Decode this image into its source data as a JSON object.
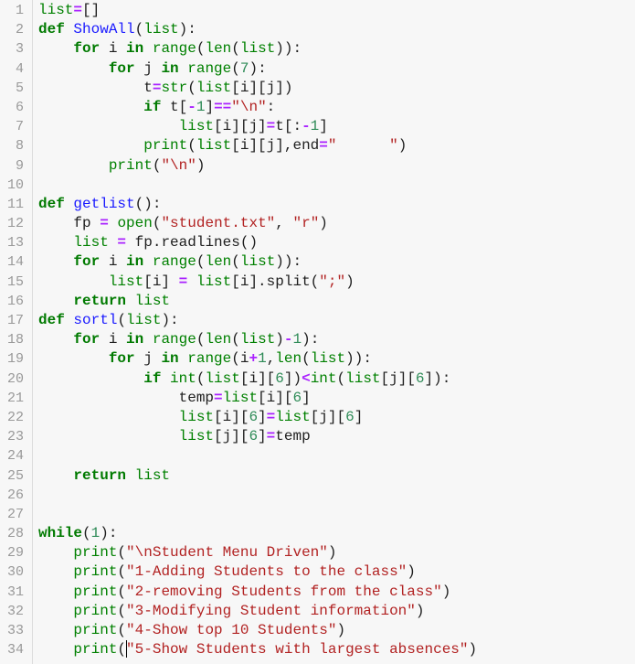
{
  "editor": {
    "cursor": {
      "line": 34,
      "after_token": 2,
      "after_char": 2
    },
    "lines": [
      {
        "n": "1",
        "tokens": [
          [
            "b",
            "list"
          ],
          [
            "o",
            "="
          ],
          [
            "p",
            "[]"
          ]
        ]
      },
      {
        "n": "2",
        "tokens": [
          [
            "k",
            "def"
          ],
          [
            "t",
            " "
          ],
          [
            "f",
            "ShowAll"
          ],
          [
            "p",
            "("
          ],
          [
            "b",
            "list"
          ],
          [
            "p",
            "):"
          ]
        ]
      },
      {
        "n": "3",
        "tokens": [
          [
            "t",
            "    "
          ],
          [
            "k",
            "for"
          ],
          [
            "t",
            " i "
          ],
          [
            "k",
            "in"
          ],
          [
            "t",
            " "
          ],
          [
            "b",
            "range"
          ],
          [
            "p",
            "("
          ],
          [
            "b",
            "len"
          ],
          [
            "p",
            "("
          ],
          [
            "b",
            "list"
          ],
          [
            "p",
            ")):"
          ]
        ]
      },
      {
        "n": "4",
        "tokens": [
          [
            "t",
            "        "
          ],
          [
            "k",
            "for"
          ],
          [
            "t",
            " j "
          ],
          [
            "k",
            "in"
          ],
          [
            "t",
            " "
          ],
          [
            "b",
            "range"
          ],
          [
            "p",
            "("
          ],
          [
            "n",
            "7"
          ],
          [
            "p",
            "):"
          ]
        ]
      },
      {
        "n": "5",
        "tokens": [
          [
            "t",
            "            t"
          ],
          [
            "o",
            "="
          ],
          [
            "b",
            "str"
          ],
          [
            "p",
            "("
          ],
          [
            "b",
            "list"
          ],
          [
            "p",
            "[i][j])"
          ]
        ]
      },
      {
        "n": "6",
        "tokens": [
          [
            "t",
            "            "
          ],
          [
            "k",
            "if"
          ],
          [
            "t",
            " t["
          ],
          [
            "o",
            "-"
          ],
          [
            "n",
            "1"
          ],
          [
            "p",
            "]"
          ],
          [
            "o",
            "=="
          ],
          [
            "s",
            "\"\\n\""
          ],
          [
            "p",
            ":"
          ]
        ]
      },
      {
        "n": "7",
        "tokens": [
          [
            "t",
            "                "
          ],
          [
            "b",
            "list"
          ],
          [
            "p",
            "[i][j]"
          ],
          [
            "o",
            "="
          ],
          [
            "t",
            "t[:"
          ],
          [
            "o",
            "-"
          ],
          [
            "n",
            "1"
          ],
          [
            "p",
            "]"
          ]
        ]
      },
      {
        "n": "8",
        "tokens": [
          [
            "t",
            "            "
          ],
          [
            "b",
            "print"
          ],
          [
            "p",
            "("
          ],
          [
            "b",
            "list"
          ],
          [
            "p",
            "[i][j],end"
          ],
          [
            "o",
            "="
          ],
          [
            "s",
            "\"      \""
          ],
          [
            "p",
            ")"
          ]
        ]
      },
      {
        "n": "9",
        "tokens": [
          [
            "t",
            "        "
          ],
          [
            "b",
            "print"
          ],
          [
            "p",
            "("
          ],
          [
            "s",
            "\"\\n\""
          ],
          [
            "p",
            ")"
          ]
        ]
      },
      {
        "n": "10",
        "tokens": []
      },
      {
        "n": "11",
        "tokens": [
          [
            "k",
            "def"
          ],
          [
            "t",
            " "
          ],
          [
            "f",
            "getlist"
          ],
          [
            "p",
            "():"
          ]
        ]
      },
      {
        "n": "12",
        "tokens": [
          [
            "t",
            "    fp "
          ],
          [
            "o",
            "="
          ],
          [
            "t",
            " "
          ],
          [
            "b",
            "open"
          ],
          [
            "p",
            "("
          ],
          [
            "s",
            "\"student.txt\""
          ],
          [
            "p",
            ", "
          ],
          [
            "s",
            "\"r\""
          ],
          [
            "p",
            ")"
          ]
        ]
      },
      {
        "n": "13",
        "tokens": [
          [
            "t",
            "    "
          ],
          [
            "b",
            "list"
          ],
          [
            "t",
            " "
          ],
          [
            "o",
            "="
          ],
          [
            "t",
            " fp.readlines()"
          ]
        ]
      },
      {
        "n": "14",
        "tokens": [
          [
            "t",
            "    "
          ],
          [
            "k",
            "for"
          ],
          [
            "t",
            " i "
          ],
          [
            "k",
            "in"
          ],
          [
            "t",
            " "
          ],
          [
            "b",
            "range"
          ],
          [
            "p",
            "("
          ],
          [
            "b",
            "len"
          ],
          [
            "p",
            "("
          ],
          [
            "b",
            "list"
          ],
          [
            "p",
            ")):"
          ]
        ]
      },
      {
        "n": "15",
        "tokens": [
          [
            "t",
            "        "
          ],
          [
            "b",
            "list"
          ],
          [
            "p",
            "[i] "
          ],
          [
            "o",
            "="
          ],
          [
            "t",
            " "
          ],
          [
            "b",
            "list"
          ],
          [
            "p",
            "[i].split("
          ],
          [
            "s",
            "\";\""
          ],
          [
            "p",
            ")"
          ]
        ]
      },
      {
        "n": "16",
        "tokens": [
          [
            "t",
            "    "
          ],
          [
            "k",
            "return"
          ],
          [
            "t",
            " "
          ],
          [
            "b",
            "list"
          ]
        ]
      },
      {
        "n": "17",
        "tokens": [
          [
            "k",
            "def"
          ],
          [
            "t",
            " "
          ],
          [
            "f",
            "sortl"
          ],
          [
            "p",
            "("
          ],
          [
            "b",
            "list"
          ],
          [
            "p",
            "):"
          ]
        ]
      },
      {
        "n": "18",
        "tokens": [
          [
            "t",
            "    "
          ],
          [
            "k",
            "for"
          ],
          [
            "t",
            " i "
          ],
          [
            "k",
            "in"
          ],
          [
            "t",
            " "
          ],
          [
            "b",
            "range"
          ],
          [
            "p",
            "("
          ],
          [
            "b",
            "len"
          ],
          [
            "p",
            "("
          ],
          [
            "b",
            "list"
          ],
          [
            "p",
            ")"
          ],
          [
            "o",
            "-"
          ],
          [
            "n",
            "1"
          ],
          [
            "p",
            "):"
          ]
        ]
      },
      {
        "n": "19",
        "tokens": [
          [
            "t",
            "        "
          ],
          [
            "k",
            "for"
          ],
          [
            "t",
            " j "
          ],
          [
            "k",
            "in"
          ],
          [
            "t",
            " "
          ],
          [
            "b",
            "range"
          ],
          [
            "p",
            "(i"
          ],
          [
            "o",
            "+"
          ],
          [
            "n",
            "1"
          ],
          [
            "p",
            ","
          ],
          [
            "b",
            "len"
          ],
          [
            "p",
            "("
          ],
          [
            "b",
            "list"
          ],
          [
            "p",
            ")):"
          ]
        ]
      },
      {
        "n": "20",
        "tokens": [
          [
            "t",
            "            "
          ],
          [
            "k",
            "if"
          ],
          [
            "t",
            " "
          ],
          [
            "b",
            "int"
          ],
          [
            "p",
            "("
          ],
          [
            "b",
            "list"
          ],
          [
            "p",
            "[i]["
          ],
          [
            "n",
            "6"
          ],
          [
            "p",
            "])"
          ],
          [
            "o",
            "<"
          ],
          [
            "b",
            "int"
          ],
          [
            "p",
            "("
          ],
          [
            "b",
            "list"
          ],
          [
            "p",
            "[j]["
          ],
          [
            "n",
            "6"
          ],
          [
            "p",
            "]):"
          ]
        ]
      },
      {
        "n": "21",
        "tokens": [
          [
            "t",
            "                temp"
          ],
          [
            "o",
            "="
          ],
          [
            "b",
            "list"
          ],
          [
            "p",
            "[i]["
          ],
          [
            "n",
            "6"
          ],
          [
            "p",
            "]"
          ]
        ]
      },
      {
        "n": "22",
        "tokens": [
          [
            "t",
            "                "
          ],
          [
            "b",
            "list"
          ],
          [
            "p",
            "[i]["
          ],
          [
            "n",
            "6"
          ],
          [
            "p",
            "]"
          ],
          [
            "o",
            "="
          ],
          [
            "b",
            "list"
          ],
          [
            "p",
            "[j]["
          ],
          [
            "n",
            "6"
          ],
          [
            "p",
            "]"
          ]
        ]
      },
      {
        "n": "23",
        "tokens": [
          [
            "t",
            "                "
          ],
          [
            "b",
            "list"
          ],
          [
            "p",
            "[j]["
          ],
          [
            "n",
            "6"
          ],
          [
            "p",
            "]"
          ],
          [
            "o",
            "="
          ],
          [
            "t",
            "temp"
          ]
        ]
      },
      {
        "n": "24",
        "tokens": []
      },
      {
        "n": "25",
        "tokens": [
          [
            "t",
            "    "
          ],
          [
            "k",
            "return"
          ],
          [
            "t",
            " "
          ],
          [
            "b",
            "list"
          ]
        ]
      },
      {
        "n": "26",
        "tokens": []
      },
      {
        "n": "27",
        "tokens": []
      },
      {
        "n": "28",
        "tokens": [
          [
            "k",
            "while"
          ],
          [
            "p",
            "("
          ],
          [
            "n",
            "1"
          ],
          [
            "p",
            "):"
          ]
        ]
      },
      {
        "n": "29",
        "tokens": [
          [
            "t",
            "    "
          ],
          [
            "b",
            "print"
          ],
          [
            "p",
            "("
          ],
          [
            "s",
            "\"\\nStudent Menu Driven\""
          ],
          [
            "p",
            ")"
          ]
        ]
      },
      {
        "n": "30",
        "tokens": [
          [
            "t",
            "    "
          ],
          [
            "b",
            "print"
          ],
          [
            "p",
            "("
          ],
          [
            "s",
            "\"1-Adding Students to the class\""
          ],
          [
            "p",
            ")"
          ]
        ]
      },
      {
        "n": "31",
        "tokens": [
          [
            "t",
            "    "
          ],
          [
            "b",
            "print"
          ],
          [
            "p",
            "("
          ],
          [
            "s",
            "\"2-removing Students from the class\""
          ],
          [
            "p",
            ")"
          ]
        ]
      },
      {
        "n": "32",
        "tokens": [
          [
            "t",
            "    "
          ],
          [
            "b",
            "print"
          ],
          [
            "p",
            "("
          ],
          [
            "s",
            "\"3-Modifying Student information\""
          ],
          [
            "p",
            ")"
          ]
        ]
      },
      {
        "n": "33",
        "tokens": [
          [
            "t",
            "    "
          ],
          [
            "b",
            "print"
          ],
          [
            "p",
            "("
          ],
          [
            "s",
            "\"4-Show top 10 Students\""
          ],
          [
            "p",
            ")"
          ]
        ]
      },
      {
        "n": "34",
        "tokens": [
          [
            "t",
            "    "
          ],
          [
            "b",
            "print"
          ],
          [
            "p",
            "("
          ],
          [
            "s",
            "\"5-Show Students with largest absences\""
          ],
          [
            "p",
            ")"
          ]
        ]
      }
    ]
  },
  "token_kinds": {
    "k": {
      "name": "keyword",
      "color": "#007a00"
    },
    "b": {
      "name": "builtin",
      "color": "#008000"
    },
    "f": {
      "name": "function-name",
      "color": "#1a1aff"
    },
    "o": {
      "name": "operator",
      "color": "#aa22ff"
    },
    "n": {
      "name": "number",
      "color": "#2e8b57"
    },
    "s": {
      "name": "string",
      "color": "#b22222"
    },
    "p": {
      "name": "punctuation",
      "color": "#1e1e1e"
    },
    "t": {
      "name": "text",
      "color": "#1e1e1e"
    }
  }
}
